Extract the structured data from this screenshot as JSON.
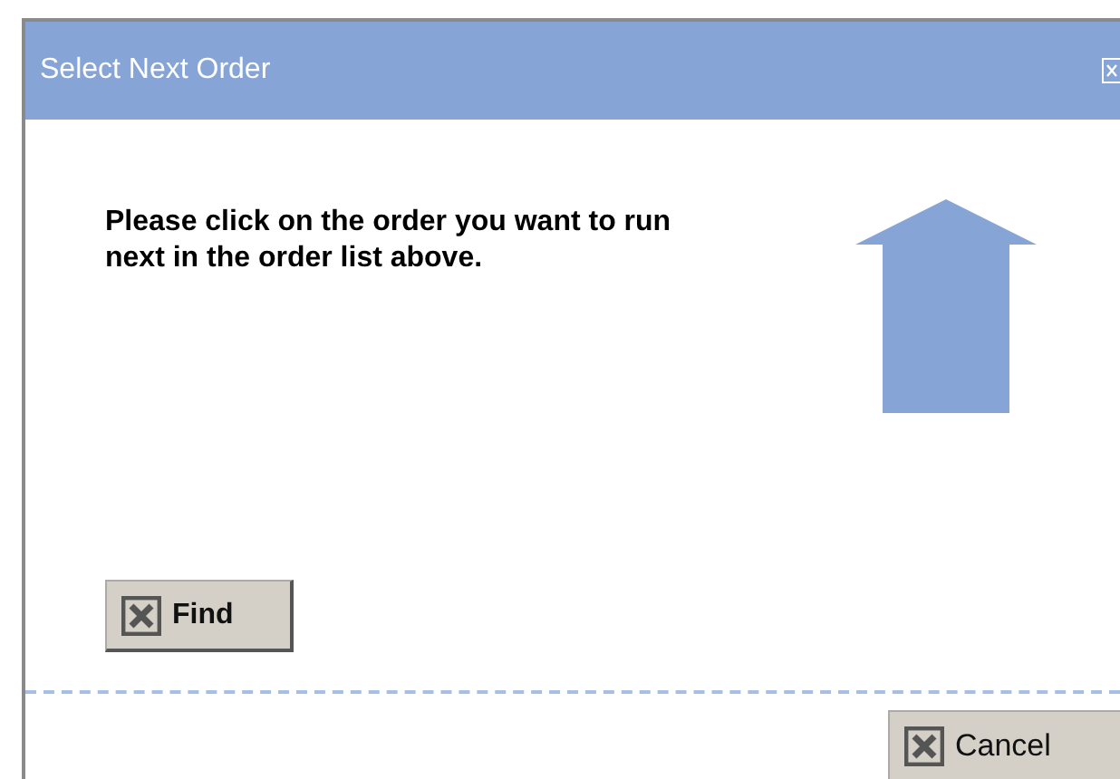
{
  "window": {
    "title": "Select Next Order"
  },
  "message": "Please click on the order you want to run next in the order list above.",
  "buttons": [
    {
      "label": "Find",
      "kind": "find"
    },
    {
      "label": "Cancel",
      "kind": "cancel"
    }
  ]
}
